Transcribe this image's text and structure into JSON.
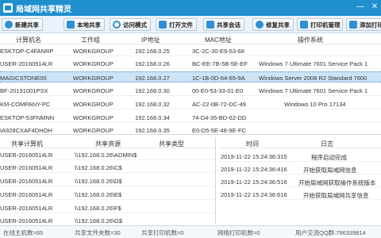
{
  "window": {
    "title": "局域网共享精灵",
    "controls": [
      "—",
      "✕"
    ]
  },
  "toolbar": {
    "buttons": [
      {
        "label": "新建共享",
        "icon": "plus-circle-icon",
        "color": "#2d8fd5"
      },
      {
        "label": "本地共享",
        "icon": "monitor-icon",
        "color": "#2d8fd5"
      },
      {
        "label": "访问模式",
        "icon": "eye-icon",
        "color": "#2d8fd5"
      },
      {
        "label": "打开文件",
        "icon": "folder-icon",
        "color": "#2d8fd5"
      },
      {
        "label": "共享会话",
        "icon": "users-icon",
        "color": "#2d8fd5"
      },
      {
        "label": "修复共享",
        "icon": "wrench-icon",
        "color": "#2d8fd5"
      },
      {
        "label": "打印机管理",
        "icon": "printer-icon",
        "color": "#2d8fd5"
      },
      {
        "label": "添加打印",
        "icon": "printer-add-icon",
        "color": "#2d8fd5"
      }
    ]
  },
  "computers": {
    "headers": [
      "计算机名",
      "工作组",
      "IP地址",
      "MAC地址",
      "操作系统"
    ],
    "rows": [
      {
        "name": "ESKTOP-C4FANRP",
        "group": "WORKGROUP",
        "ip": "192.168.0.25",
        "mac": "3C-2C-30-E9-53-68",
        "os": ""
      },
      {
        "name": "USER-20160514LR",
        "group": "WORKGROUP",
        "ip": "192.168.0.26",
        "mac": "BC-EE-7B-5B-5E-EF",
        "os": "Windows 7 Ultimate 7601 Service Pack 1"
      },
      {
        "name": "MAGICSTONE00",
        "group": "WORKGROUP",
        "ip": "192.168.0.27",
        "mac": "1C-1B-0D-64-65-9A",
        "os": "Windows Server 2008 R2 Standard 7600"
      },
      {
        "name": "BF-20191001PSX",
        "group": "WORKGROUP",
        "ip": "192.168.0.30",
        "mac": "00-E0-53-33-01-E0",
        "os": "Windows 7 Ultimate 7601 Service Pack 1"
      },
      {
        "name": "KM-COMPANY-PC",
        "group": "WORKGROUP",
        "ip": "192.168.0.32",
        "mac": "AC-22-0B-72-DC-49",
        "os": "Windows 10 Pro 17134"
      },
      {
        "name": "ESKTOP-53FNMNN",
        "group": "WORKGROUP",
        "ip": "192.168.0.34",
        "mac": "74-D4-35-BD-62-DD",
        "os": ""
      },
      {
        "name": "IA928CXAF4DHOH",
        "group": "WORKGROUP",
        "ip": "192.168.0.35",
        "mac": "E0-D5-5E-48-9E-FC",
        "os": ""
      }
    ],
    "selected_index": 2
  },
  "shares": {
    "headers": [
      "共享计算机",
      "共享资源",
      "共享类型"
    ],
    "rows": [
      {
        "computer": "USER-20160514LR",
        "resource": "\\\\192.168.0.26\\ADMIN$",
        "type": ""
      },
      {
        "computer": "USER-20160514LR",
        "resource": "\\\\192.168.0.26\\C$",
        "type": ""
      },
      {
        "computer": "USER-20160514LR",
        "resource": "\\\\192.168.0.26\\D$",
        "type": ""
      },
      {
        "computer": "USER-20160514LR",
        "resource": "\\\\192.168.0.26\\E$",
        "type": ""
      },
      {
        "computer": "USER-20160514LR",
        "resource": "\\\\192.168.0.26\\F$",
        "type": ""
      },
      {
        "computer": "USER-20160514LR",
        "resource": "\\\\192.168.0.26\\G$",
        "type": ""
      }
    ]
  },
  "logs": {
    "headers": [
      "时间",
      "日志"
    ],
    "rows": [
      {
        "time": "2019-11-22 15:24:36:315",
        "message": "程序启动完成"
      },
      {
        "time": "2019-11-22 15:24:36:416",
        "message": "开始获取局域网信息"
      },
      {
        "time": "2019-11-22 15:24:36:516",
        "message": "开始局域网获取操作系统版本"
      },
      {
        "time": "2019-11-22 15:24:36:616",
        "message": "开始获取局域网共享信息"
      }
    ]
  },
  "status": {
    "online": "在线主机数=65",
    "shared_folders": "共享文件夹数=30",
    "shared_printers": "共享打印机数=0",
    "network_printers": "网络打印机数=0",
    "support": "用户交流QQ群:796339814"
  }
}
